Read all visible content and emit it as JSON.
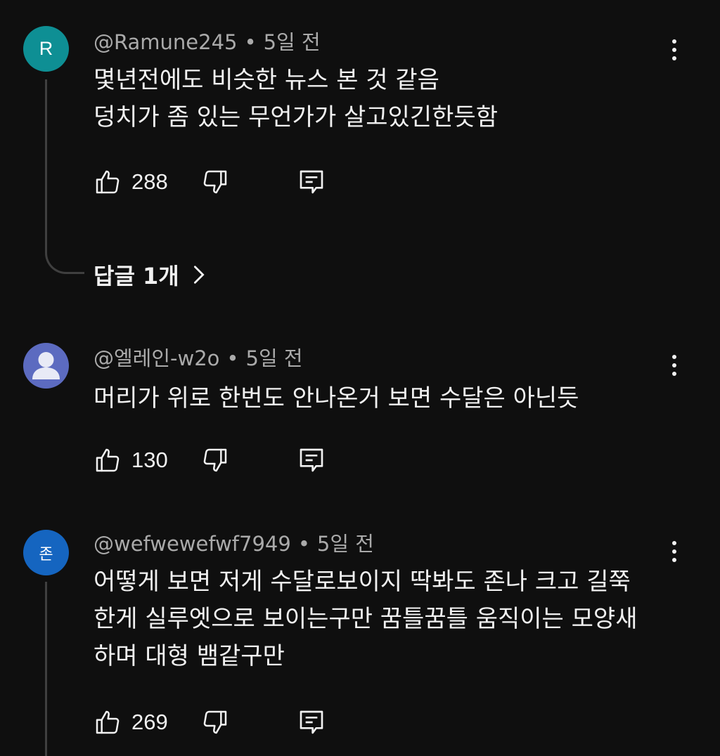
{
  "comments": [
    {
      "author": "@Ramune245",
      "time": "5일 전",
      "avatar_text": "R",
      "avatar_color": "#0e8f94",
      "lines": [
        "몇년전에도 비슷한 뉴스 본 것 같음",
        "덩치가 좀 있는 무언가가 살고있긴한듯함"
      ],
      "likes": "288",
      "replies_label": "답글 1개"
    },
    {
      "author": "@엘레인-w2o",
      "time": "5일 전",
      "avatar_text": "",
      "avatar_color": "#5c6bc0",
      "lines": [
        "머리가 위로 한번도 안나온거 보면 수달은 아닌듯"
      ],
      "likes": "130"
    },
    {
      "author": "@wefwewefwf7949",
      "time": "5일 전",
      "avatar_text": "존",
      "avatar_color": "#1565c0",
      "lines": [
        "어떻게 보면 저게 수달로보이지 딱봐도 존나 크고 길쭉",
        "한게 실루엣으로 보이는구만 꿈틀꿈틀 움직이는 모양새",
        "하며 대형 뱀같구만"
      ],
      "likes": "269"
    }
  ],
  "icons": {
    "like": "thumbs-up-icon",
    "dislike": "thumbs-down-icon",
    "reply": "reply-icon",
    "more": "more-vertical-icon",
    "chevron": "chevron-right-icon"
  },
  "colors": {
    "background": "#0f0f0f",
    "text": "#f1f1f1",
    "meta": "#aaaaaa",
    "thread": "#3f3f3f"
  }
}
